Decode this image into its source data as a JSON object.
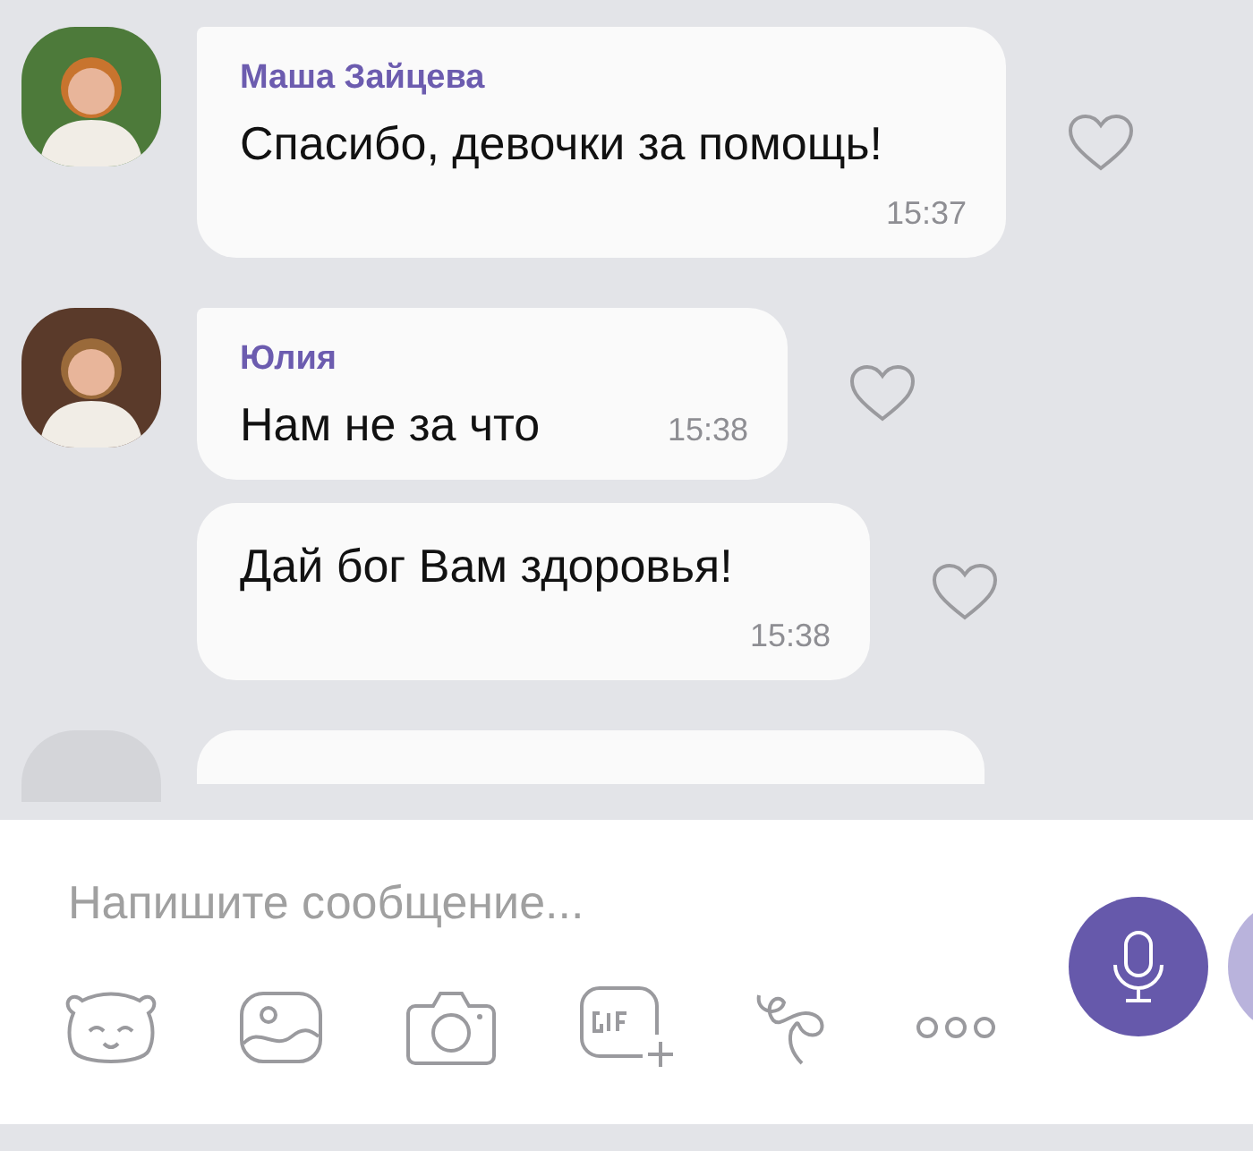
{
  "messages": [
    {
      "kind": "first",
      "sender": "Маша Зайцева",
      "text": "Спасибо, девочки за помощь!",
      "time": "15:37"
    },
    {
      "kind": "first",
      "sender": "Юлия",
      "text": "Нам не за что",
      "time": "15:38"
    },
    {
      "kind": "continued",
      "text": "Дай бог Вам здоровья!",
      "time": "15:38"
    }
  ],
  "composer": {
    "placeholder": "Напишите сообщение..."
  }
}
